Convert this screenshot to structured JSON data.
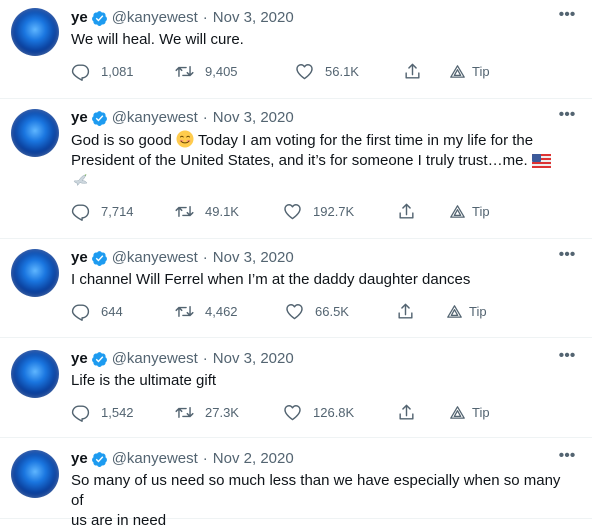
{
  "tweets": [
    {
      "name": "ye",
      "handle": "@kanyewest",
      "sep": "·",
      "date": "Nov 3, 2020",
      "text": "We will heal. We will cure.",
      "replies": "1,081",
      "retweets": "9,405",
      "likes": "56.1K",
      "tip": "Tip"
    },
    {
      "name": "ye",
      "handle": "@kanyewest",
      "sep": "·",
      "date": "Nov 3, 2020",
      "text_a": "God is so good",
      "text_b": "Today I am voting for the first time in my life for the",
      "text_c": "President of the United States, and it’s for someone I truly trust…me.",
      "replies": "7,714",
      "retweets": "49.1K",
      "likes": "192.7K",
      "tip": "Tip"
    },
    {
      "name": "ye",
      "handle": "@kanyewest",
      "sep": "·",
      "date": "Nov 3, 2020",
      "text": "I channel Will Ferrel when I’m at the daddy daughter dances",
      "replies": "644",
      "retweets": "4,462",
      "likes": "66.5K",
      "tip": "Tip"
    },
    {
      "name": "ye",
      "handle": "@kanyewest",
      "sep": "·",
      "date": "Nov 3, 2020",
      "text": "Life is the ultimate gift",
      "replies": "1,542",
      "retweets": "27.3K",
      "likes": "126.8K",
      "tip": "Tip"
    },
    {
      "name": "ye",
      "handle": "@kanyewest",
      "sep": "·",
      "date": "Nov 2, 2020",
      "text_line1": "So many of us need so much less than we have especially when so many of",
      "text_line2": "us are in need"
    }
  ],
  "colors": {
    "text": "#0f1419",
    "muted": "#536471",
    "verified": "#1d9bf0",
    "divider": "#eff3f4"
  },
  "icons": [
    "verified-badge-icon",
    "more-icon",
    "reply-icon",
    "retweet-icon",
    "like-icon",
    "share-icon",
    "tip-icon",
    "smiling-face-emoji",
    "us-flag-emoji",
    "dove-emoji"
  ]
}
